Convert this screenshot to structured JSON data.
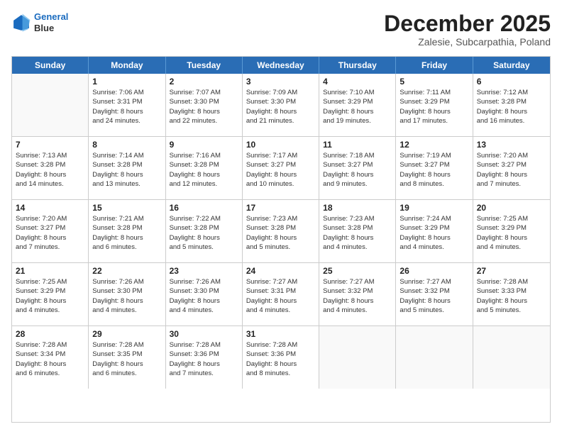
{
  "header": {
    "logo_line1": "General",
    "logo_line2": "Blue",
    "month_title": "December 2025",
    "location": "Zalesie, Subcarpathia, Poland"
  },
  "days_of_week": [
    "Sunday",
    "Monday",
    "Tuesday",
    "Wednesday",
    "Thursday",
    "Friday",
    "Saturday"
  ],
  "weeks": [
    [
      {
        "day": "",
        "info": ""
      },
      {
        "day": "1",
        "info": "Sunrise: 7:06 AM\nSunset: 3:31 PM\nDaylight: 8 hours\nand 24 minutes."
      },
      {
        "day": "2",
        "info": "Sunrise: 7:07 AM\nSunset: 3:30 PM\nDaylight: 8 hours\nand 22 minutes."
      },
      {
        "day": "3",
        "info": "Sunrise: 7:09 AM\nSunset: 3:30 PM\nDaylight: 8 hours\nand 21 minutes."
      },
      {
        "day": "4",
        "info": "Sunrise: 7:10 AM\nSunset: 3:29 PM\nDaylight: 8 hours\nand 19 minutes."
      },
      {
        "day": "5",
        "info": "Sunrise: 7:11 AM\nSunset: 3:29 PM\nDaylight: 8 hours\nand 17 minutes."
      },
      {
        "day": "6",
        "info": "Sunrise: 7:12 AM\nSunset: 3:28 PM\nDaylight: 8 hours\nand 16 minutes."
      }
    ],
    [
      {
        "day": "7",
        "info": "Sunrise: 7:13 AM\nSunset: 3:28 PM\nDaylight: 8 hours\nand 14 minutes."
      },
      {
        "day": "8",
        "info": "Sunrise: 7:14 AM\nSunset: 3:28 PM\nDaylight: 8 hours\nand 13 minutes."
      },
      {
        "day": "9",
        "info": "Sunrise: 7:16 AM\nSunset: 3:28 PM\nDaylight: 8 hours\nand 12 minutes."
      },
      {
        "day": "10",
        "info": "Sunrise: 7:17 AM\nSunset: 3:27 PM\nDaylight: 8 hours\nand 10 minutes."
      },
      {
        "day": "11",
        "info": "Sunrise: 7:18 AM\nSunset: 3:27 PM\nDaylight: 8 hours\nand 9 minutes."
      },
      {
        "day": "12",
        "info": "Sunrise: 7:19 AM\nSunset: 3:27 PM\nDaylight: 8 hours\nand 8 minutes."
      },
      {
        "day": "13",
        "info": "Sunrise: 7:20 AM\nSunset: 3:27 PM\nDaylight: 8 hours\nand 7 minutes."
      }
    ],
    [
      {
        "day": "14",
        "info": "Sunrise: 7:20 AM\nSunset: 3:27 PM\nDaylight: 8 hours\nand 7 minutes."
      },
      {
        "day": "15",
        "info": "Sunrise: 7:21 AM\nSunset: 3:28 PM\nDaylight: 8 hours\nand 6 minutes."
      },
      {
        "day": "16",
        "info": "Sunrise: 7:22 AM\nSunset: 3:28 PM\nDaylight: 8 hours\nand 5 minutes."
      },
      {
        "day": "17",
        "info": "Sunrise: 7:23 AM\nSunset: 3:28 PM\nDaylight: 8 hours\nand 5 minutes."
      },
      {
        "day": "18",
        "info": "Sunrise: 7:23 AM\nSunset: 3:28 PM\nDaylight: 8 hours\nand 4 minutes."
      },
      {
        "day": "19",
        "info": "Sunrise: 7:24 AM\nSunset: 3:29 PM\nDaylight: 8 hours\nand 4 minutes."
      },
      {
        "day": "20",
        "info": "Sunrise: 7:25 AM\nSunset: 3:29 PM\nDaylight: 8 hours\nand 4 minutes."
      }
    ],
    [
      {
        "day": "21",
        "info": "Sunrise: 7:25 AM\nSunset: 3:29 PM\nDaylight: 8 hours\nand 4 minutes."
      },
      {
        "day": "22",
        "info": "Sunrise: 7:26 AM\nSunset: 3:30 PM\nDaylight: 8 hours\nand 4 minutes."
      },
      {
        "day": "23",
        "info": "Sunrise: 7:26 AM\nSunset: 3:30 PM\nDaylight: 8 hours\nand 4 minutes."
      },
      {
        "day": "24",
        "info": "Sunrise: 7:27 AM\nSunset: 3:31 PM\nDaylight: 8 hours\nand 4 minutes."
      },
      {
        "day": "25",
        "info": "Sunrise: 7:27 AM\nSunset: 3:32 PM\nDaylight: 8 hours\nand 4 minutes."
      },
      {
        "day": "26",
        "info": "Sunrise: 7:27 AM\nSunset: 3:32 PM\nDaylight: 8 hours\nand 5 minutes."
      },
      {
        "day": "27",
        "info": "Sunrise: 7:28 AM\nSunset: 3:33 PM\nDaylight: 8 hours\nand 5 minutes."
      }
    ],
    [
      {
        "day": "28",
        "info": "Sunrise: 7:28 AM\nSunset: 3:34 PM\nDaylight: 8 hours\nand 6 minutes."
      },
      {
        "day": "29",
        "info": "Sunrise: 7:28 AM\nSunset: 3:35 PM\nDaylight: 8 hours\nand 6 minutes."
      },
      {
        "day": "30",
        "info": "Sunrise: 7:28 AM\nSunset: 3:36 PM\nDaylight: 8 hours\nand 7 minutes."
      },
      {
        "day": "31",
        "info": "Sunrise: 7:28 AM\nSunset: 3:36 PM\nDaylight: 8 hours\nand 8 minutes."
      },
      {
        "day": "",
        "info": ""
      },
      {
        "day": "",
        "info": ""
      },
      {
        "day": "",
        "info": ""
      }
    ]
  ]
}
